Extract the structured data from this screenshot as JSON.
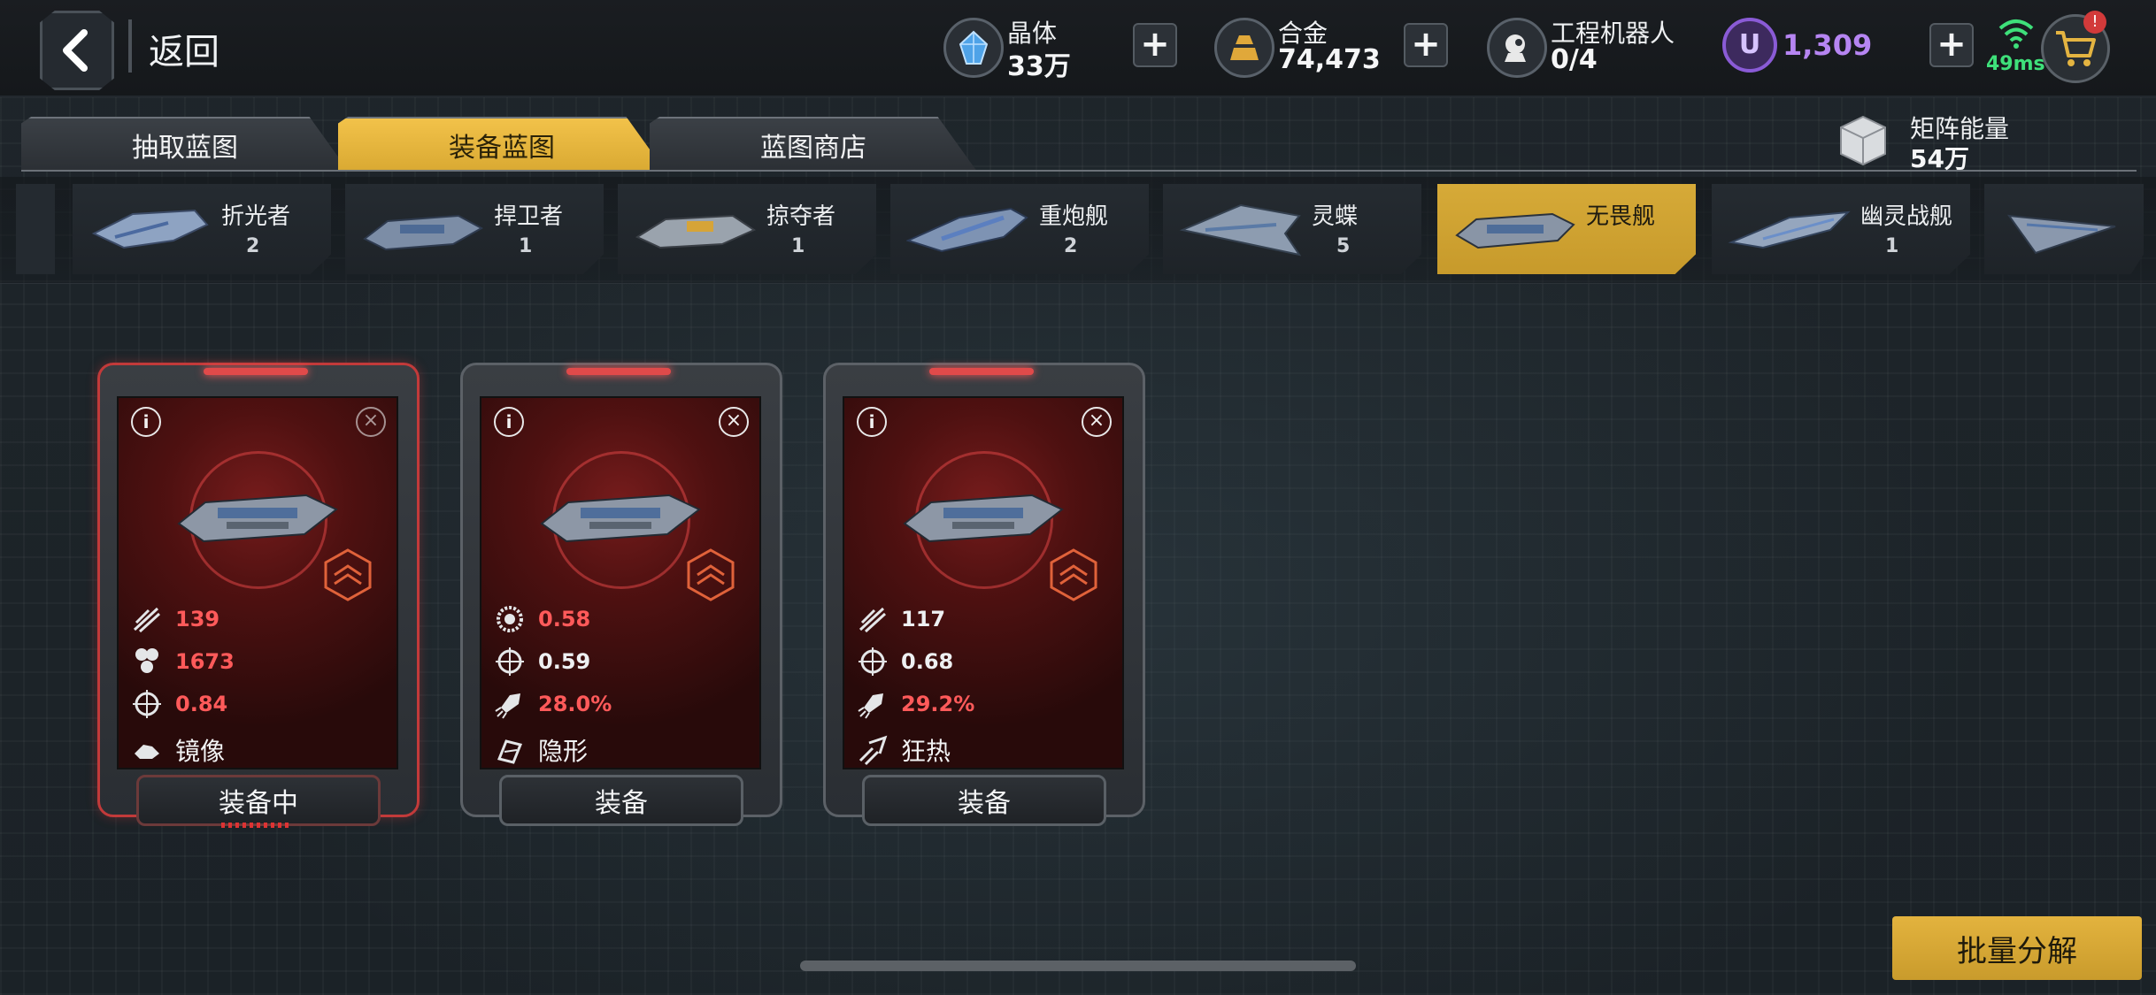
{
  "header": {
    "back_label": "返回",
    "resources": [
      {
        "name": "晶体",
        "value": "33万"
      },
      {
        "name": "合金",
        "value": "74,473"
      },
      {
        "name": "工程机器人",
        "value": "0/4"
      }
    ],
    "currency_value": "1,309",
    "currency_symbol": "U",
    "ping": "49ms"
  },
  "tabs": [
    {
      "label": "抽取蓝图",
      "active": false
    },
    {
      "label": "装备蓝图",
      "active": true
    },
    {
      "label": "蓝图商店",
      "active": false
    }
  ],
  "matrix_energy": {
    "name": "矩阵能量",
    "value": "54万"
  },
  "ship_types": [
    {
      "name": "折光者",
      "count": "2"
    },
    {
      "name": "捍卫者",
      "count": "1"
    },
    {
      "name": "掠夺者",
      "count": "1"
    },
    {
      "name": "重炮舰",
      "count": "2"
    },
    {
      "name": "灵蝶",
      "count": "5"
    },
    {
      "name": "无畏舰",
      "count": "",
      "active": true
    },
    {
      "name": "幽灵战舰",
      "count": "1"
    }
  ],
  "blueprints": [
    {
      "stats": [
        {
          "icon": "missile-icon",
          "value": "139",
          "color": "red"
        },
        {
          "icon": "hex-cluster-icon",
          "value": "1673",
          "color": "red"
        },
        {
          "icon": "crosshair-icon",
          "value": "0.84",
          "color": "red"
        }
      ],
      "skill": "镜像",
      "button": "装备中",
      "equipped": true
    },
    {
      "stats": [
        {
          "icon": "sun-gear-icon",
          "value": "0.58",
          "color": "red"
        },
        {
          "icon": "crosshair-icon",
          "value": "0.59",
          "color": "white"
        },
        {
          "icon": "rocket-icon",
          "value": "28.0%",
          "color": "red"
        }
      ],
      "skill": "隐形",
      "button": "装备",
      "equipped": false
    },
    {
      "stats": [
        {
          "icon": "missile-icon",
          "value": "117",
          "color": "white"
        },
        {
          "icon": "crosshair-icon",
          "value": "0.68",
          "color": "white"
        },
        {
          "icon": "rocket-icon",
          "value": "29.2%",
          "color": "red"
        }
      ],
      "skill": "狂热",
      "button": "装备",
      "equipped": false
    }
  ],
  "bulk_button": "批量分解",
  "colors": {
    "accent": "#e3b33e",
    "stat_red": "#ff5a5a",
    "currency": "#b685f2",
    "ping": "#3ee07a"
  }
}
